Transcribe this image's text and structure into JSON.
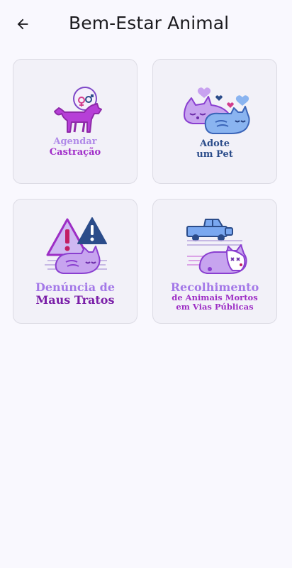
{
  "header": {
    "title": "Bem-Estar Animal",
    "back_icon": "arrow-left-icon"
  },
  "cards": [
    {
      "name": "castracao",
      "line1": "Agendar",
      "line2": "Castração",
      "line3": ""
    },
    {
      "name": "adote",
      "line1": "Adote",
      "line2": "um Pet",
      "line3": ""
    },
    {
      "name": "denuncia",
      "line1": "Denúncia de",
      "line2": "Maus Tratos",
      "line3": ""
    },
    {
      "name": "recolhimento",
      "line1": "Recolhimento",
      "line2": "de Animais Mortos",
      "line3": "em Vias Públicas"
    }
  ],
  "colors": {
    "background": "#f9f8fe",
    "card": "#f2f1f8",
    "purple": "#9d2ec5",
    "violet": "#a479e8",
    "navy": "#2b4c8a",
    "blue": "#7aa8f0"
  }
}
